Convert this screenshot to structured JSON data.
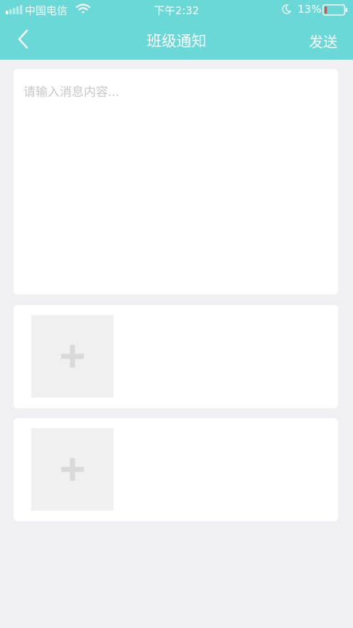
{
  "status_bar": {
    "carrier": "中国电信",
    "time": "下午2:32",
    "battery_percent": "13%",
    "battery_level": 0.13,
    "icons": [
      "signal-icon",
      "wifi-icon",
      "moon-icon",
      "battery-icon"
    ]
  },
  "nav": {
    "back_icon": "chevron-left-icon",
    "title": "班级通知",
    "send_label": "发送"
  },
  "message": {
    "value": "",
    "placeholder": "请输入消息内容..."
  },
  "attachments": {
    "add_icon": "plus-icon",
    "slots": [
      {
        "label": ""
      },
      {
        "label": ""
      }
    ]
  },
  "colors": {
    "header": "#69d8d6",
    "background": "#efeff4",
    "card": "#ffffff",
    "placeholder": "#c7c7cc",
    "tile": "#f0f0f0",
    "plus": "#d9d9d9",
    "battery_low": "#e54b4b"
  }
}
